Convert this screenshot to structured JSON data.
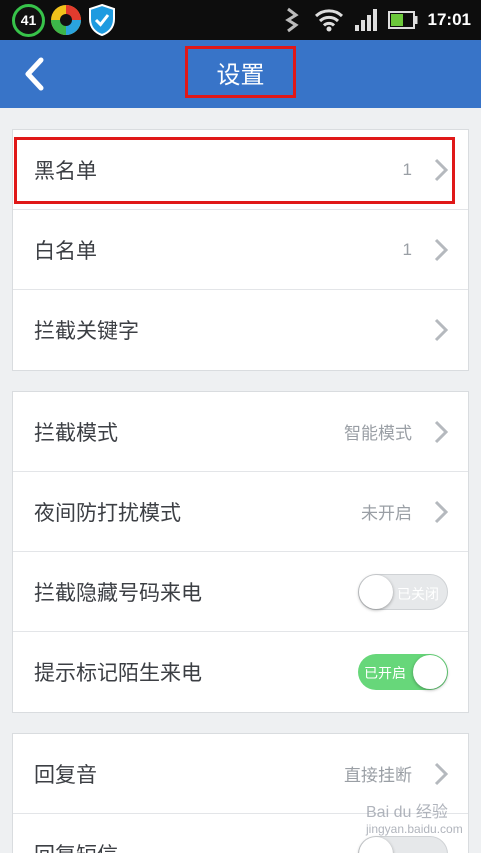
{
  "status_bar": {
    "time": "17:01",
    "notification_badge": "41"
  },
  "header": {
    "title": "设置",
    "back_icon": "chevron-left-icon"
  },
  "groups": [
    {
      "rows": [
        {
          "label": "黑名单",
          "value": "1",
          "chevron": true
        },
        {
          "label": "白名单",
          "value": "1",
          "chevron": true
        },
        {
          "label": "拦截关键字",
          "value": "",
          "chevron": true
        }
      ]
    },
    {
      "rows": [
        {
          "label": "拦截模式",
          "value": "智能模式",
          "chevron": true
        },
        {
          "label": "夜间防打扰模式",
          "value": "未开启",
          "chevron": true
        },
        {
          "label": "拦截隐藏号码来电",
          "toggle": {
            "state": "off",
            "text": "已关闭"
          }
        },
        {
          "label": "提示标记陌生来电",
          "toggle": {
            "state": "on",
            "text": "已开启"
          }
        }
      ]
    },
    {
      "rows": [
        {
          "label": "回复音",
          "value": "直接挂断",
          "chevron": true
        },
        {
          "label": "回复短信",
          "toggle": {
            "state": "off",
            "text": ""
          }
        }
      ]
    }
  ],
  "colors": {
    "header_bg": "#3874c8",
    "toggle_on": "#67d77a",
    "highlight": "#e01818"
  },
  "watermark": {
    "text": "Bai du 经验",
    "sub": "jingyan.baidu.com"
  }
}
